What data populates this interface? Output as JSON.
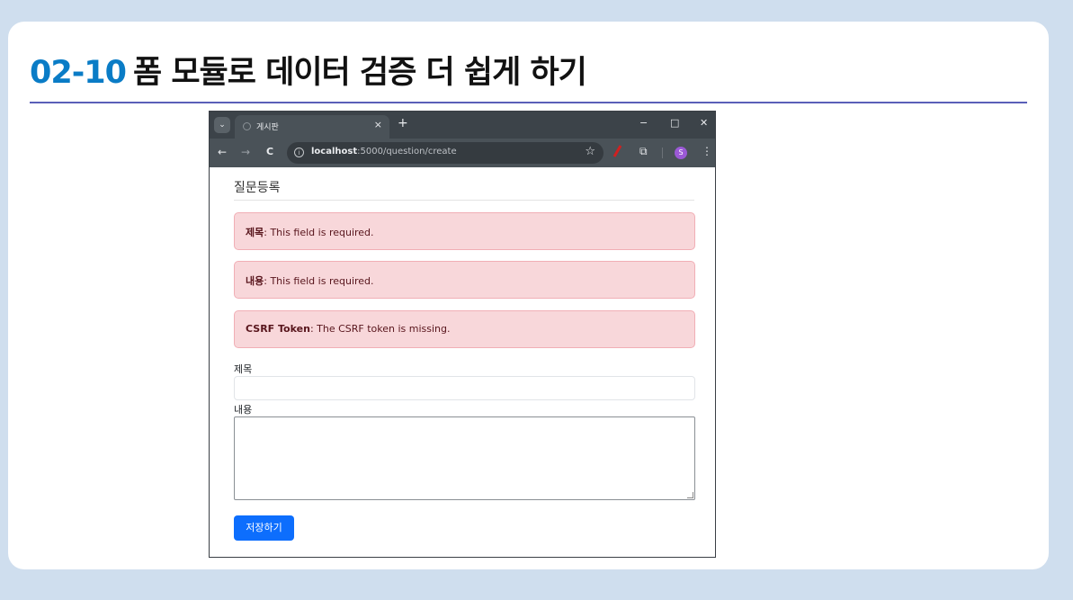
{
  "slide": {
    "title_number": "02-10",
    "title_text": "폼 모듈로 데이터 검증 더 쉽게 하기"
  },
  "browser": {
    "tab_title": "게시판",
    "tab_close": "×",
    "new_tab": "+",
    "window_controls": {
      "minimize": "−",
      "maximize": "□",
      "close": "✕"
    },
    "nav": {
      "back": "←",
      "forward": "→",
      "reload": "C"
    },
    "url_host": "localhost",
    "url_path": ":5000/question/create",
    "profile_initial": "S"
  },
  "page": {
    "heading": "질문등록",
    "alerts": [
      {
        "field": "제목",
        "message": ": This field is required."
      },
      {
        "field": "내용",
        "message": ": This field is required."
      },
      {
        "field": "CSRF Token",
        "message": ": The CSRF token is missing."
      }
    ],
    "subject_label": "제목",
    "subject_value": "",
    "content_label": "내용",
    "content_value": "",
    "save_label": "저장하기"
  },
  "colors": {
    "slide_background": "#cfdeee",
    "title_accent": "#0a7cc6",
    "alert_background": "#f8d7da",
    "alert_text": "#58151c",
    "primary_button": "#0d6efd"
  }
}
